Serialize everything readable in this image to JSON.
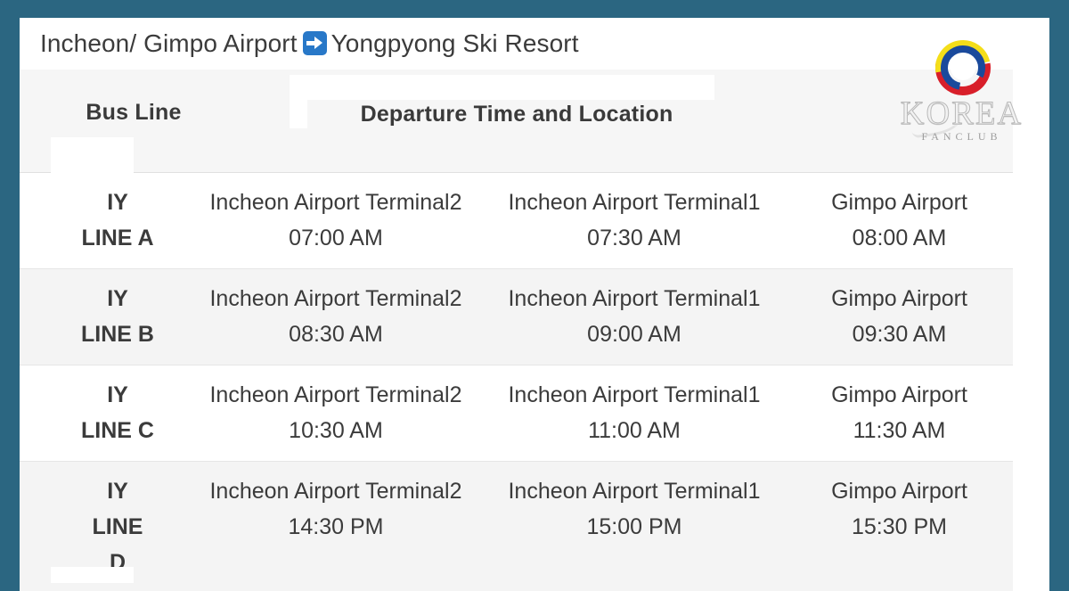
{
  "frame": {
    "border_color": "#2b6681",
    "sheet_bg": "#ffffff"
  },
  "title": {
    "prefix": "Incheon/ Gimpo Airport",
    "arrow_icon": "right-arrow-icon",
    "suffix": "Yongpyong Ski Resort"
  },
  "logo": {
    "brand": "KOREA",
    "sub": "FANCLUB",
    "ring_colors": {
      "yellow": "#f4de1a",
      "blue": "#1a4a9c",
      "red": "#d81f2a"
    }
  },
  "table": {
    "headers": {
      "bus_line": "Bus  Line",
      "departure": "Departure Time and Location"
    },
    "rows": [
      {
        "line_l1": "IY",
        "line_l2": "LINE A",
        "line_l3": "",
        "striped": false,
        "stops": [
          {
            "location": "Incheon Airport Terminal2",
            "time": "07:00 AM"
          },
          {
            "location": "Incheon Airport Terminal1",
            "time": "07:30 AM"
          },
          {
            "location": "Gimpo Airport",
            "time": "08:00 AM"
          }
        ]
      },
      {
        "line_l1": "IY",
        "line_l2": "LINE B",
        "line_l3": "",
        "striped": true,
        "stops": [
          {
            "location": "Incheon Airport Terminal2",
            "time": "08:30 AM"
          },
          {
            "location": "Incheon Airport Terminal1",
            "time": "09:00 AM"
          },
          {
            "location": "Gimpo Airport",
            "time": "09:30 AM"
          }
        ]
      },
      {
        "line_l1": "IY",
        "line_l2": "LINE C",
        "line_l3": "",
        "striped": false,
        "stops": [
          {
            "location": "Incheon Airport Terminal2",
            "time": "10:30 AM"
          },
          {
            "location": "Incheon Airport Terminal1",
            "time": "11:00 AM"
          },
          {
            "location": "Gimpo Airport",
            "time": "11:30 AM"
          }
        ]
      },
      {
        "line_l1": "IY",
        "line_l2": "LINE",
        "line_l3": "D",
        "striped": true,
        "stops": [
          {
            "location": "Incheon Airport Terminal2",
            "time": "14:30 PM"
          },
          {
            "location": "Incheon Airport Terminal1",
            "time": "15:00 PM"
          },
          {
            "location": "Gimpo Airport",
            "time": "15:30 PM"
          }
        ]
      }
    ]
  }
}
